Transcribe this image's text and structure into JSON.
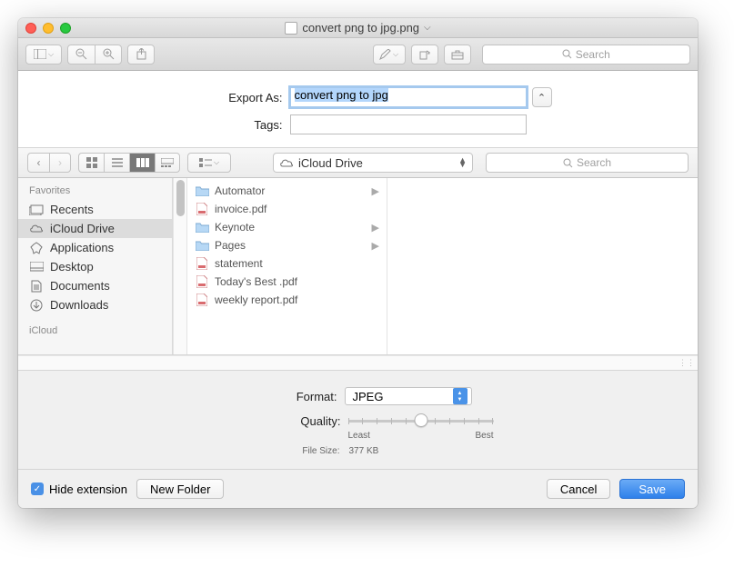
{
  "window": {
    "title": "convert png to jpg.png"
  },
  "toolbar": {
    "search_placeholder": "Search"
  },
  "export": {
    "export_as_label": "Export As:",
    "filename": "convert png to jpg",
    "tags_label": "Tags:"
  },
  "browser": {
    "location": "iCloud Drive",
    "search_placeholder": "Search",
    "sidebar": {
      "header": "Favorites",
      "items": [
        {
          "label": "Recents",
          "icon": "recents"
        },
        {
          "label": "iCloud Drive",
          "icon": "cloud",
          "selected": true
        },
        {
          "label": "Applications",
          "icon": "apps"
        },
        {
          "label": "Desktop",
          "icon": "desktop"
        },
        {
          "label": "Documents",
          "icon": "documents"
        },
        {
          "label": "Downloads",
          "icon": "downloads"
        }
      ],
      "truncated_section": "iCloud"
    },
    "column_items": [
      {
        "name": "Automator",
        "type": "folder",
        "has_children": true
      },
      {
        "name": "invoice.pdf",
        "type": "pdf"
      },
      {
        "name": "Keynote",
        "type": "folder",
        "has_children": true
      },
      {
        "name": "Pages",
        "type": "folder",
        "has_children": true
      },
      {
        "name": "statement",
        "type": "pdf"
      },
      {
        "name": "Today's Best .pdf",
        "type": "pdf"
      },
      {
        "name": "weekly report.pdf",
        "type": "pdf"
      }
    ]
  },
  "format": {
    "format_label": "Format:",
    "format_value": "JPEG",
    "quality_label": "Quality:",
    "least_label": "Least",
    "best_label": "Best",
    "filesize_label": "File Size:",
    "filesize_value": "377 KB"
  },
  "bottom": {
    "hide_ext_label": "Hide extension",
    "hide_ext_checked": true,
    "new_folder": "New Folder",
    "cancel": "Cancel",
    "save": "Save"
  }
}
